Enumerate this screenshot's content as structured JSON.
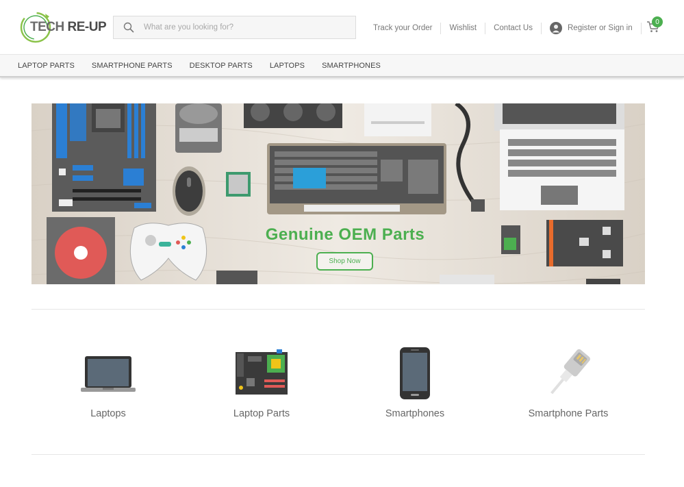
{
  "brand": {
    "logo_part1": "TECH ",
    "logo_part2": "RE-UP",
    "accent_color": "#4caf50"
  },
  "search": {
    "placeholder": "What are you looking for?",
    "icon": "search-icon"
  },
  "toplinks": {
    "track_order": "Track your Order",
    "wishlist": "Wishlist",
    "contact": "Contact Us",
    "account": "Register or Sign in",
    "cart_count": "0"
  },
  "nav": {
    "items": [
      "LAPTOP PARTS",
      "SMARTPHONE PARTS",
      "DESKTOP PARTS",
      "LAPTOPS",
      "SMARTPHONES"
    ]
  },
  "banner": {
    "title": "Genuine OEM Parts",
    "button": "Shop Now"
  },
  "categories": [
    {
      "label": "Laptops",
      "icon": "laptop-icon"
    },
    {
      "label": "Laptop Parts",
      "icon": "motherboard-icon"
    },
    {
      "label": "Smartphones",
      "icon": "smartphone-icon"
    },
    {
      "label": "Smartphone Parts",
      "icon": "cable-icon"
    }
  ]
}
